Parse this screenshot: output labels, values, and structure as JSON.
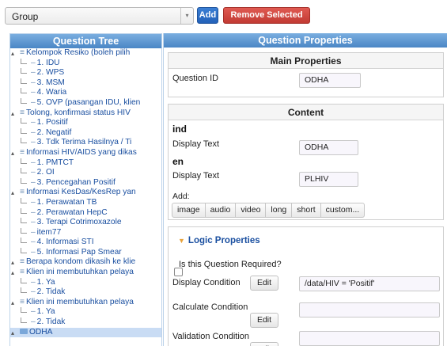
{
  "toolbar": {
    "group_value": "Group",
    "add_label": "Add",
    "remove_label": "Remove Selected"
  },
  "tree": {
    "header": "Question Tree",
    "nodes": [
      {
        "label": "Kelompok Resiko (boleh pilih",
        "level": 0
      },
      {
        "label": "1. IDU",
        "level": 1
      },
      {
        "label": "2. WPS",
        "level": 1
      },
      {
        "label": "3. MSM",
        "level": 1
      },
      {
        "label": "4. Waria",
        "level": 1
      },
      {
        "label": "5. OVP (pasangan IDU, klien",
        "level": 1
      },
      {
        "label": "Tolong, konfirmasi status HIV",
        "level": 0
      },
      {
        "label": "1. Positif",
        "level": 1
      },
      {
        "label": "2. Negatif",
        "level": 1
      },
      {
        "label": "3. Tdk Terima Hasilnya / Ti",
        "level": 1
      },
      {
        "label": "Informasi HIV/AIDS yang dikas",
        "level": 0
      },
      {
        "label": "1. PMTCT",
        "level": 1
      },
      {
        "label": "2. OI",
        "level": 1
      },
      {
        "label": "3. Pencegahan Positif",
        "level": 1
      },
      {
        "label": "Informasi KesDas/KesRep yan",
        "level": 0
      },
      {
        "label": "1. Perawatan TB",
        "level": 1
      },
      {
        "label": "2. Perawatan HepC",
        "level": 1
      },
      {
        "label": "3. Terapi Cotrimoxazole",
        "level": 1
      },
      {
        "label": "item77",
        "level": 1
      },
      {
        "label": "4. Informasi STI",
        "level": 1
      },
      {
        "label": "5. Informasi Pap Smear",
        "level": 1
      },
      {
        "label": "Berapa kondom dikasih ke klie",
        "level": 0
      },
      {
        "label": "Klien ini membutuhkan pelaya",
        "level": 0
      },
      {
        "label": "1. Ya",
        "level": 1
      },
      {
        "label": "2. Tidak",
        "level": 1
      },
      {
        "label": "Klien ini membutuhkan pelaya",
        "level": 0
      },
      {
        "label": "1. Ya",
        "level": 1
      },
      {
        "label": "2. Tidak",
        "level": 1
      },
      {
        "label": "ODHA",
        "level": 0,
        "selected": true
      }
    ]
  },
  "properties": {
    "header": "Question Properties",
    "main": {
      "title": "Main Properties",
      "question_id_label": "Question ID",
      "question_id_value": "ODHA"
    },
    "content": {
      "title": "Content",
      "lang1": "ind",
      "lang1_display_label": "Display Text",
      "lang1_display_value": "ODHA",
      "lang2": "en",
      "lang2_display_label": "Display Text",
      "lang2_display_value": "PLHIV",
      "add_label": "Add:",
      "media_buttons": [
        "image",
        "audio",
        "video",
        "long",
        "short",
        "custom..."
      ]
    },
    "logic": {
      "title": "Logic Properties",
      "required_label": "Is this Question Required?",
      "display_condition_label": "Display Condition",
      "display_condition_value": "/data/HIV = 'Positif'",
      "calculate_condition_label": "Calculate Condition",
      "calculate_condition_value": "",
      "validation_condition_label": "Validation Condition",
      "validation_condition_value": "",
      "edit_label": "Edit"
    }
  }
}
